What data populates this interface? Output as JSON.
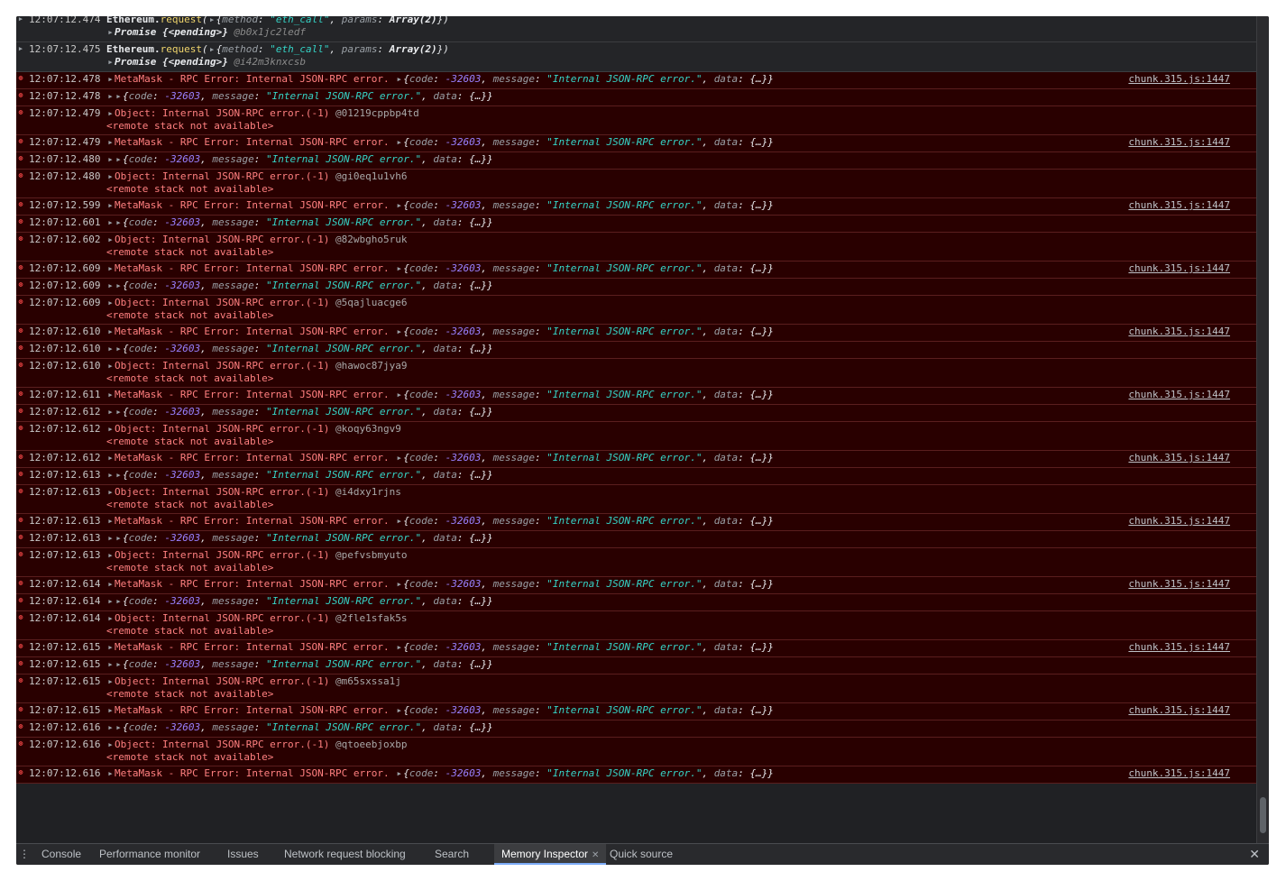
{
  "entries": [
    {
      "type": "info",
      "time": "12:07:12.474",
      "id": "@b0x1jc2ledf"
    },
    {
      "type": "info",
      "time": "12:07:12.475",
      "id": "@i42m3knxcsb"
    },
    {
      "type": "meta",
      "time": "12:07:12.478"
    },
    {
      "type": "obj",
      "time": "12:07:12.478"
    },
    {
      "type": "remote",
      "time": "12:07:12.479",
      "id": "@01219cppbp4td"
    },
    {
      "type": "meta",
      "time": "12:07:12.479"
    },
    {
      "type": "obj",
      "time": "12:07:12.480"
    },
    {
      "type": "remote",
      "time": "12:07:12.480",
      "id": "@gi0eq1u1vh6"
    },
    {
      "type": "meta",
      "time": "12:07:12.599"
    },
    {
      "type": "obj",
      "time": "12:07:12.601"
    },
    {
      "type": "remote",
      "time": "12:07:12.602",
      "id": "@82wbgho5ruk"
    },
    {
      "type": "meta",
      "time": "12:07:12.609"
    },
    {
      "type": "obj",
      "time": "12:07:12.609"
    },
    {
      "type": "remote",
      "time": "12:07:12.609",
      "id": "@5qajluacge6"
    },
    {
      "type": "meta",
      "time": "12:07:12.610"
    },
    {
      "type": "obj",
      "time": "12:07:12.610"
    },
    {
      "type": "remote",
      "time": "12:07:12.610",
      "id": "@hawoc87jya9"
    },
    {
      "type": "meta",
      "time": "12:07:12.611"
    },
    {
      "type": "obj",
      "time": "12:07:12.612"
    },
    {
      "type": "remote",
      "time": "12:07:12.612",
      "id": "@koqy63ngv9"
    },
    {
      "type": "meta",
      "time": "12:07:12.612"
    },
    {
      "type": "obj",
      "time": "12:07:12.613"
    },
    {
      "type": "remote",
      "time": "12:07:12.613",
      "id": "@i4dxy1rjns"
    },
    {
      "type": "meta",
      "time": "12:07:12.613"
    },
    {
      "type": "obj",
      "time": "12:07:12.613"
    },
    {
      "type": "remote",
      "time": "12:07:12.613",
      "id": "@pefvsbmyuto"
    },
    {
      "type": "meta",
      "time": "12:07:12.614"
    },
    {
      "type": "obj",
      "time": "12:07:12.614"
    },
    {
      "type": "remote",
      "time": "12:07:12.614",
      "id": "@2fle1sfak5s"
    },
    {
      "type": "meta",
      "time": "12:07:12.615"
    },
    {
      "type": "obj",
      "time": "12:07:12.615"
    },
    {
      "type": "remote",
      "time": "12:07:12.615",
      "id": "@m65sxssa1j"
    },
    {
      "type": "meta",
      "time": "12:07:12.615"
    },
    {
      "type": "obj",
      "time": "12:07:12.616"
    },
    {
      "type": "remote",
      "time": "12:07:12.616",
      "id": "@qtoeebjoxbp"
    },
    {
      "type": "meta",
      "time": "12:07:12.616"
    }
  ],
  "text": {
    "eth_prefix": "Ethereum.",
    "eth_method": "request",
    "eth_args_open": "(",
    "brace_open": "{",
    "method_key": "method",
    "method_val": "\"eth_call\"",
    "params_key": "params",
    "params_val": "Array(2)",
    "eth_args_close": "})",
    "promise_label": "Promise",
    "promise_state": "{<pending>}",
    "meta_msg": "MetaMask - RPC Error: Internal JSON-RPC error.",
    "code_key": "code",
    "code_val": "-32603",
    "message_key": "message",
    "message_val": "\"Internal JSON-RPC error.\"",
    "data_key": "data",
    "data_val": "{…}}",
    "obj_msg": "Object: Internal JSON-RPC error.(-1)",
    "remote_stack": "<remote stack not available>",
    "source_link": "chunk.315.js:1447"
  },
  "drawer": {
    "tabs": [
      {
        "label": "Console",
        "active": false
      },
      {
        "label": "Performance monitor",
        "active": false
      },
      {
        "label": "Issues",
        "active": false
      },
      {
        "label": "Network request blocking",
        "active": false
      },
      {
        "label": "Search",
        "active": false
      },
      {
        "label": "Memory Inspector",
        "active": true
      },
      {
        "label": "Quick source",
        "active": false
      }
    ],
    "menu_icon": "vertical-dots-icon",
    "close_icon": "close-icon"
  },
  "colors": {
    "error_bg": "#290000",
    "error_text": "#ff8080",
    "string": "#35d4c7",
    "number": "#9980ff",
    "method": "#f0d56c"
  }
}
